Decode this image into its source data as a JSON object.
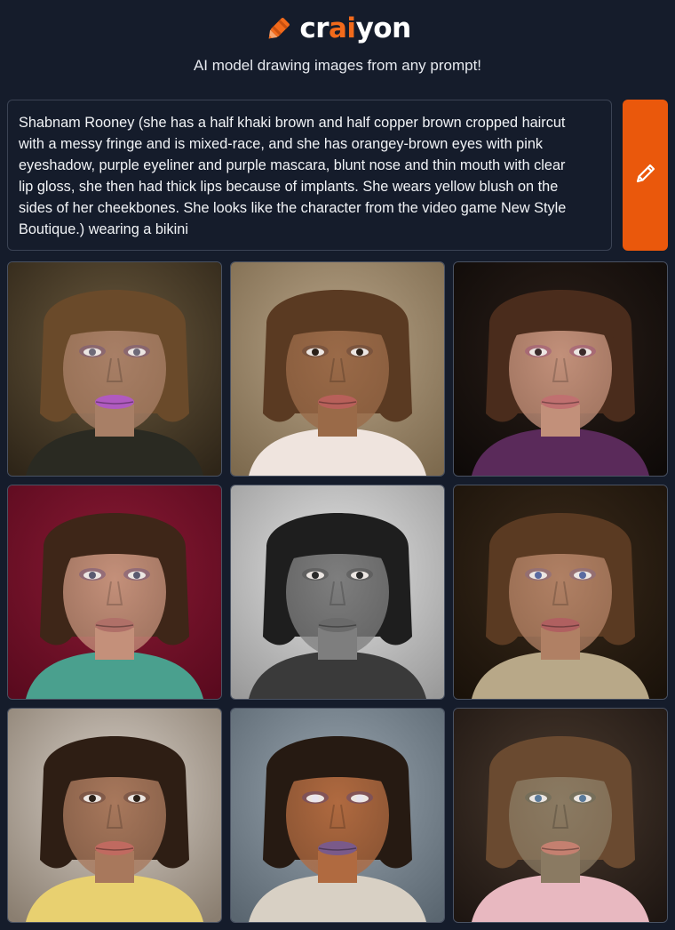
{
  "header": {
    "brand_prefix": "cr",
    "brand_accent": "ai",
    "brand_suffix": "yon",
    "tagline": "AI model drawing images from any prompt!",
    "logo_icon": "crayon-icon"
  },
  "prompt": {
    "text": "Shabnam Rooney (she has a half khaki brown and half copper brown cropped haircut\nwith a messy fringe and is mixed-race, and she has orangey-brown eyes with pink\neyeshadow, purple eyeliner and purple mascara, blunt nose and thin mouth with clear\nlip gloss, she then had thick lips because of implants. She wears yellow blush on the\nsides of her cheekbones. She looks like the character from the video game New Style\nBoutique.) wearing a bikini",
    "draw_button_icon": "pencil-icon"
  },
  "colors": {
    "background": "#151c2b",
    "accent": "#ea580c",
    "brand_accent": "#f26a1b",
    "border": "#3b4354"
  },
  "results": [
    {
      "bg": [
        "#6b5a3e",
        "#2e2518"
      ],
      "skin": "#a87f66",
      "hair": "#6a4a2a",
      "lips": "#b05ac0",
      "cloth": "#2a2a22",
      "eyes": "#6e6a78",
      "eyeshadow": "#7a5a78",
      "gray": false
    },
    {
      "bg": [
        "#b8a488",
        "#7d6a4e"
      ],
      "skin": "#9a6a48",
      "hair": "#5a3a22",
      "lips": "#b8605a",
      "cloth": "#efe4de",
      "eyes": "#2a2018",
      "eyeshadow": "#6a4a3a",
      "gray": false
    },
    {
      "bg": [
        "#2a1e18",
        "#0e0a08"
      ],
      "skin": "#c2907a",
      "hair": "#4a2c1c",
      "lips": "#c07070",
      "cloth": "#5a2a5a",
      "eyes": "#3a2a2a",
      "eyeshadow": "#a05a7a",
      "gray": false
    },
    {
      "bg": [
        "#8a1a34",
        "#5a0a1e"
      ],
      "skin": "#c4907a",
      "hair": "#3e2618",
      "lips": "#b07068",
      "cloth": "#4aa08e",
      "eyes": "#5a5a70",
      "eyeshadow": "#7a5a7a",
      "gray": false
    },
    {
      "bg": [
        "#e4e4e4",
        "#9a9a9a"
      ],
      "skin": "#7e7e7e",
      "hair": "#1e1e1e",
      "lips": "#6a6a6a",
      "cloth": "#3a3a3a",
      "eyes": "#2a2a2a",
      "eyeshadow": "#555555",
      "gray": true
    },
    {
      "bg": [
        "#3a2a1a",
        "#1a120a"
      ],
      "skin": "#b08064",
      "hair": "#5a3a22",
      "lips": "#b06060",
      "cloth": "#b8a888",
      "eyes": "#5a6aa0",
      "eyeshadow": "#8a6a80",
      "gray": false
    },
    {
      "bg": [
        "#d8d0c8",
        "#8a7e70"
      ],
      "skin": "#a8785c",
      "hair": "#2e1e14",
      "lips": "#c06a60",
      "cloth": "#e8d070",
      "eyes": "#2a2018",
      "eyeshadow": "#6a4a40",
      "gray": false
    },
    {
      "bg": [
        "#9aa6b0",
        "#5a6670"
      ],
      "skin": "#b06a40",
      "hair": "#261a12",
      "lips": "#7a5a8a",
      "cloth": "#d8d0c4",
      "eyes": "#e8e4ee",
      "eyeshadow": "#6a4a6a",
      "gray": false
    },
    {
      "bg": [
        "#4a3a2e",
        "#1e1612"
      ],
      "skin": "#8a7a62",
      "hair": "#6a4a30",
      "lips": "#c48070",
      "cloth": "#e8b8c0",
      "eyes": "#5a7a9a",
      "eyeshadow": "#6a6a5a",
      "gray": false
    }
  ]
}
